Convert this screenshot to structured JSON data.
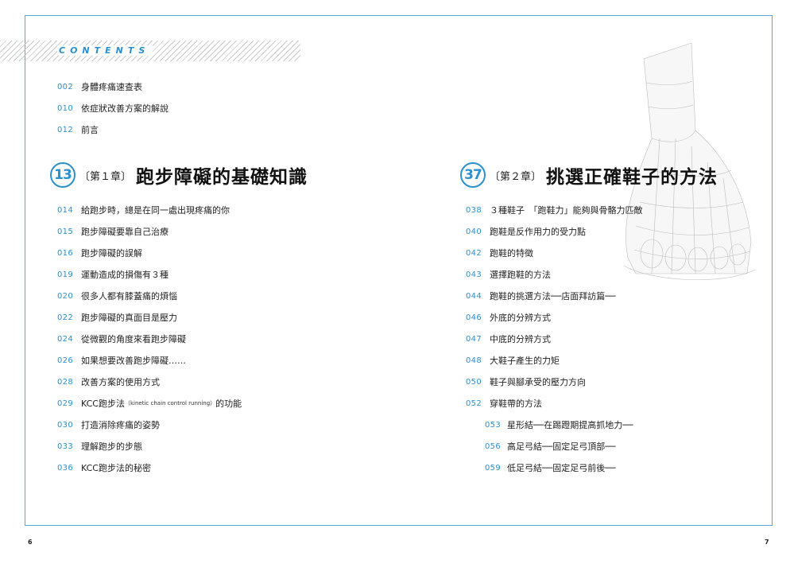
{
  "header": {
    "label": "CONTENTS"
  },
  "intro": [
    {
      "page": "002",
      "title": "身體疼痛速查表"
    },
    {
      "page": "010",
      "title": "依症狀改善方案的解說"
    },
    {
      "page": "012",
      "title": "前言"
    }
  ],
  "chapter1": {
    "number": "13",
    "tag": "〔第１章〕",
    "title": "跑步障礙的基礎知識",
    "entries": [
      {
        "page": "014",
        "title": "給跑步時，總是在同一處出現疼痛的你"
      },
      {
        "page": "015",
        "title": "跑步障礙要靠自己治療"
      },
      {
        "page": "016",
        "title": "跑步障礙的誤解"
      },
      {
        "page": "019",
        "title": "運動造成的損傷有３種"
      },
      {
        "page": "020",
        "title": "很多人都有膝蓋痛的煩惱"
      },
      {
        "page": "022",
        "title": "跑步障礙的真面目是壓力"
      },
      {
        "page": "024",
        "title": "從微觀的角度來看跑步障礙"
      },
      {
        "page": "026",
        "title": "如果想要改善跑步障礙……"
      },
      {
        "page": "028",
        "title": "改善方案的使用方式"
      },
      {
        "page": "029",
        "title": "KCC跑步法",
        "note": "（kinetic chain control running）",
        "title_end": "的功能"
      },
      {
        "page": "030",
        "title": "打造消除疼痛的姿勢"
      },
      {
        "page": "033",
        "title": "理解跑步的步態"
      },
      {
        "page": "036",
        "title": "KCC跑步法的秘密"
      }
    ]
  },
  "chapter2": {
    "number": "37",
    "tag": "〔第２章〕",
    "title": "挑選正確鞋子的方法",
    "entries": [
      {
        "page": "038",
        "title": "３種鞋子　「跑鞋力」能夠與骨骼力匹敵"
      },
      {
        "page": "040",
        "title": "跑鞋是反作用力的受力點"
      },
      {
        "page": "042",
        "title": "跑鞋的特徵"
      },
      {
        "page": "043",
        "title": "選擇跑鞋的方法"
      },
      {
        "page": "044",
        "title": "跑鞋的挑選方法──店面拜訪篇──"
      },
      {
        "page": "046",
        "title": "外底的分辨方式"
      },
      {
        "page": "047",
        "title": "中底的分辨方式"
      },
      {
        "page": "048",
        "title": "大鞋子產生的力矩"
      },
      {
        "page": "050",
        "title": "鞋子與腳承受的壓力方向"
      },
      {
        "page": "052",
        "title": "穿鞋帶的方法"
      }
    ],
    "sub_entries": [
      {
        "page": "053",
        "title": "星形結──在踢蹬期提高抓地力──"
      },
      {
        "page": "056",
        "title": "高足弓結──固定足弓頂部──"
      },
      {
        "page": "059",
        "title": "低足弓結──固定足弓前後──"
      }
    ]
  },
  "footer": {
    "left_page": "6",
    "right_page": "7"
  }
}
